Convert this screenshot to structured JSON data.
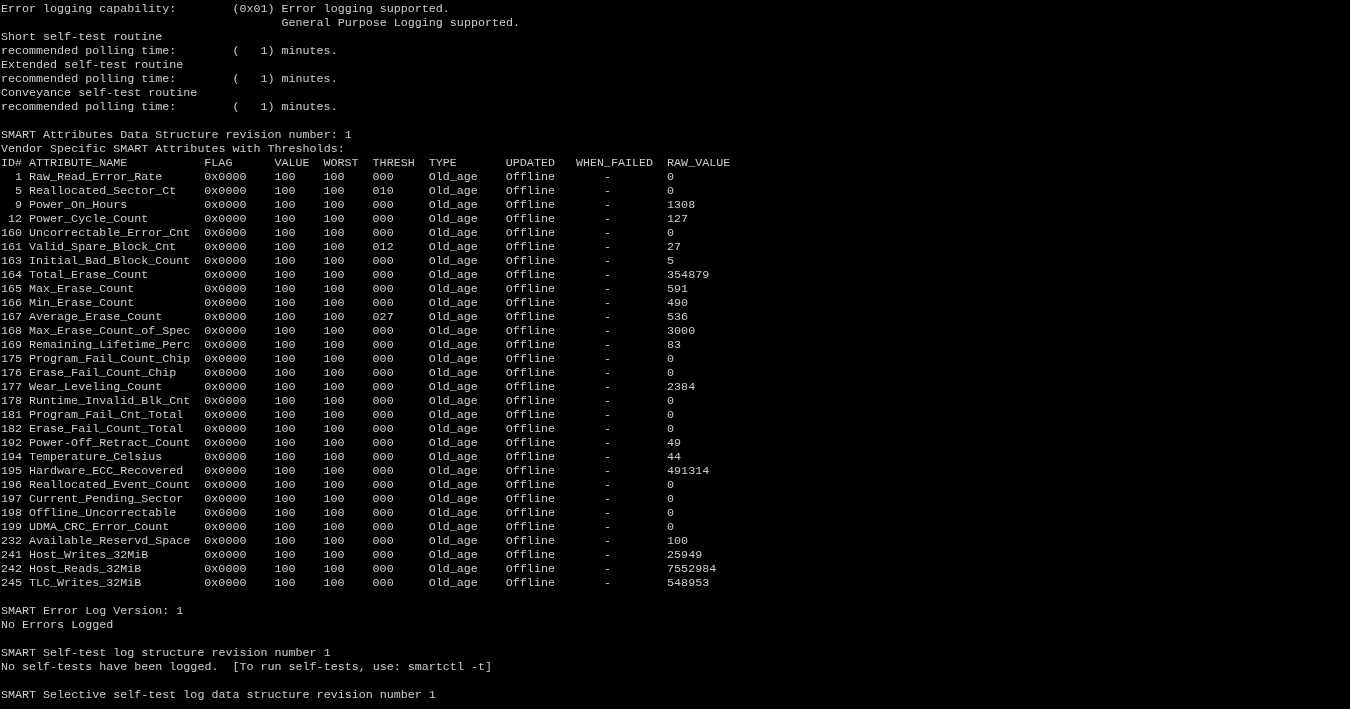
{
  "sections": [
    {
      "lines": [
        {
          "kind": "field",
          "label": "Error logging capability:",
          "value": "(0x01) Error logging supported."
        },
        {
          "kind": "continuation",
          "value": "General Purpose Logging supported."
        },
        {
          "kind": "plain",
          "value": "Short self-test routine"
        },
        {
          "kind": "field",
          "label": "recommended polling time:",
          "value": "(   1) minutes."
        },
        {
          "kind": "plain",
          "value": "Extended self-test routine"
        },
        {
          "kind": "field",
          "label": "recommended polling time:",
          "value": "(   1) minutes."
        },
        {
          "kind": "plain",
          "value": "Conveyance self-test routine"
        },
        {
          "kind": "field",
          "label": "recommended polling time:",
          "value": "(   1) minutes."
        }
      ]
    },
    {
      "lines": [
        {
          "kind": "plain",
          "value": "SMART Attributes Data Structure revision number: 1"
        },
        {
          "kind": "plain",
          "value": "Vendor Specific SMART Attributes with Thresholds:"
        }
      ],
      "table": {
        "columns": [
          "ID#",
          "ATTRIBUTE_NAME",
          "FLAG",
          "VALUE",
          "WORST",
          "THRESH",
          "TYPE",
          "UPDATED",
          "WHEN_FAILED",
          "RAW_VALUE"
        ],
        "rows": [
          [
            "1",
            "Raw_Read_Error_Rate",
            "0x0000",
            "100",
            "100",
            "000",
            "Old_age",
            "Offline",
            "-",
            "0"
          ],
          [
            "5",
            "Reallocated_Sector_Ct",
            "0x0000",
            "100",
            "100",
            "010",
            "Old_age",
            "Offline",
            "-",
            "0"
          ],
          [
            "9",
            "Power_On_Hours",
            "0x0000",
            "100",
            "100",
            "000",
            "Old_age",
            "Offline",
            "-",
            "1308"
          ],
          [
            "12",
            "Power_Cycle_Count",
            "0x0000",
            "100",
            "100",
            "000",
            "Old_age",
            "Offline",
            "-",
            "127"
          ],
          [
            "160",
            "Uncorrectable_Error_Cnt",
            "0x0000",
            "100",
            "100",
            "000",
            "Old_age",
            "Offline",
            "-",
            "0"
          ],
          [
            "161",
            "Valid_Spare_Block_Cnt",
            "0x0000",
            "100",
            "100",
            "012",
            "Old_age",
            "Offline",
            "-",
            "27"
          ],
          [
            "163",
            "Initial_Bad_Block_Count",
            "0x0000",
            "100",
            "100",
            "000",
            "Old_age",
            "Offline",
            "-",
            "5"
          ],
          [
            "164",
            "Total_Erase_Count",
            "0x0000",
            "100",
            "100",
            "000",
            "Old_age",
            "Offline",
            "-",
            "354879"
          ],
          [
            "165",
            "Max_Erase_Count",
            "0x0000",
            "100",
            "100",
            "000",
            "Old_age",
            "Offline",
            "-",
            "591"
          ],
          [
            "166",
            "Min_Erase_Count",
            "0x0000",
            "100",
            "100",
            "000",
            "Old_age",
            "Offline",
            "-",
            "490"
          ],
          [
            "167",
            "Average_Erase_Count",
            "0x0000",
            "100",
            "100",
            "027",
            "Old_age",
            "Offline",
            "-",
            "536"
          ],
          [
            "168",
            "Max_Erase_Count_of_Spec",
            "0x0000",
            "100",
            "100",
            "000",
            "Old_age",
            "Offline",
            "-",
            "3000"
          ],
          [
            "169",
            "Remaining_Lifetime_Perc",
            "0x0000",
            "100",
            "100",
            "000",
            "Old_age",
            "Offline",
            "-",
            "83"
          ],
          [
            "175",
            "Program_Fail_Count_Chip",
            "0x0000",
            "100",
            "100",
            "000",
            "Old_age",
            "Offline",
            "-",
            "0"
          ],
          [
            "176",
            "Erase_Fail_Count_Chip",
            "0x0000",
            "100",
            "100",
            "000",
            "Old_age",
            "Offline",
            "-",
            "0"
          ],
          [
            "177",
            "Wear_Leveling_Count",
            "0x0000",
            "100",
            "100",
            "000",
            "Old_age",
            "Offline",
            "-",
            "2384"
          ],
          [
            "178",
            "Runtime_Invalid_Blk_Cnt",
            "0x0000",
            "100",
            "100",
            "000",
            "Old_age",
            "Offline",
            "-",
            "0"
          ],
          [
            "181",
            "Program_Fail_Cnt_Total",
            "0x0000",
            "100",
            "100",
            "000",
            "Old_age",
            "Offline",
            "-",
            "0"
          ],
          [
            "182",
            "Erase_Fail_Count_Total",
            "0x0000",
            "100",
            "100",
            "000",
            "Old_age",
            "Offline",
            "-",
            "0"
          ],
          [
            "192",
            "Power-Off_Retract_Count",
            "0x0000",
            "100",
            "100",
            "000",
            "Old_age",
            "Offline",
            "-",
            "49"
          ],
          [
            "194",
            "Temperature_Celsius",
            "0x0000",
            "100",
            "100",
            "000",
            "Old_age",
            "Offline",
            "-",
            "44"
          ],
          [
            "195",
            "Hardware_ECC_Recovered",
            "0x0000",
            "100",
            "100",
            "000",
            "Old_age",
            "Offline",
            "-",
            "491314"
          ],
          [
            "196",
            "Reallocated_Event_Count",
            "0x0000",
            "100",
            "100",
            "000",
            "Old_age",
            "Offline",
            "-",
            "0"
          ],
          [
            "197",
            "Current_Pending_Sector",
            "0x0000",
            "100",
            "100",
            "000",
            "Old_age",
            "Offline",
            "-",
            "0"
          ],
          [
            "198",
            "Offline_Uncorrectable",
            "0x0000",
            "100",
            "100",
            "000",
            "Old_age",
            "Offline",
            "-",
            "0"
          ],
          [
            "199",
            "UDMA_CRC_Error_Count",
            "0x0000",
            "100",
            "100",
            "000",
            "Old_age",
            "Offline",
            "-",
            "0"
          ],
          [
            "232",
            "Available_Reservd_Space",
            "0x0000",
            "100",
            "100",
            "000",
            "Old_age",
            "Offline",
            "-",
            "100"
          ],
          [
            "241",
            "Host_Writes_32MiB",
            "0x0000",
            "100",
            "100",
            "000",
            "Old_age",
            "Offline",
            "-",
            "25949"
          ],
          [
            "242",
            "Host_Reads_32MiB",
            "0x0000",
            "100",
            "100",
            "000",
            "Old_age",
            "Offline",
            "-",
            "7552984"
          ],
          [
            "245",
            "TLC_Writes_32MiB",
            "0x0000",
            "100",
            "100",
            "000",
            "Old_age",
            "Offline",
            "-",
            "548953"
          ]
        ]
      }
    },
    {
      "lines": [
        {
          "kind": "plain",
          "value": "SMART Error Log Version: 1"
        },
        {
          "kind": "plain",
          "value": "No Errors Logged"
        }
      ]
    },
    {
      "lines": [
        {
          "kind": "plain",
          "value": "SMART Self-test log structure revision number 1"
        },
        {
          "kind": "plain",
          "value": "No self-tests have been logged.  [To run self-tests, use: smartctl -t]"
        }
      ]
    },
    {
      "lines": [
        {
          "kind": "plain",
          "value": "SMART Selective self-test log data structure revision number 1"
        }
      ]
    }
  ]
}
